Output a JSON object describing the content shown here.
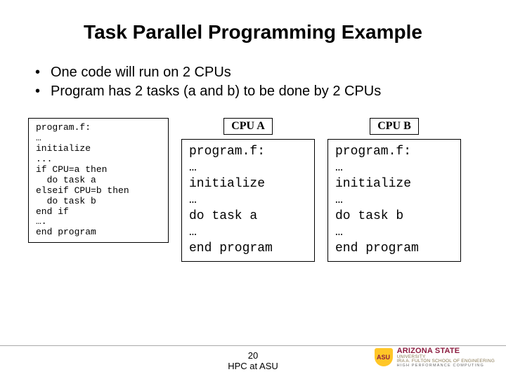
{
  "title": "Task Parallel Programming Example",
  "bullets": [
    "One code will run on 2 CPUs",
    "Program has 2 tasks (a and b) to be done by 2 CPUs"
  ],
  "source_code": "program.f:\n…\ninitialize\n...\nif CPU=a then\n  do task a\nelseif CPU=b then\n  do task b\nend if\n….\nend program",
  "cpu_a": {
    "label": "CPU A",
    "code": "program.f:\n…\ninitialize\n…\ndo task a\n…\nend program"
  },
  "cpu_b": {
    "label": "CPU B",
    "code": "program.f:\n…\ninitialize\n…\ndo task b\n…\nend program"
  },
  "footer": {
    "page_number": "20",
    "course": "HPC at ASU"
  },
  "logo": {
    "shield": "ASU",
    "name": "ARIZONA STATE",
    "sub1": "UNIVERSITY",
    "sub2": "IRA A. FULTON SCHOOL OF ENGINEERING",
    "sub3": "HIGH PERFORMANCE COMPUTING"
  }
}
